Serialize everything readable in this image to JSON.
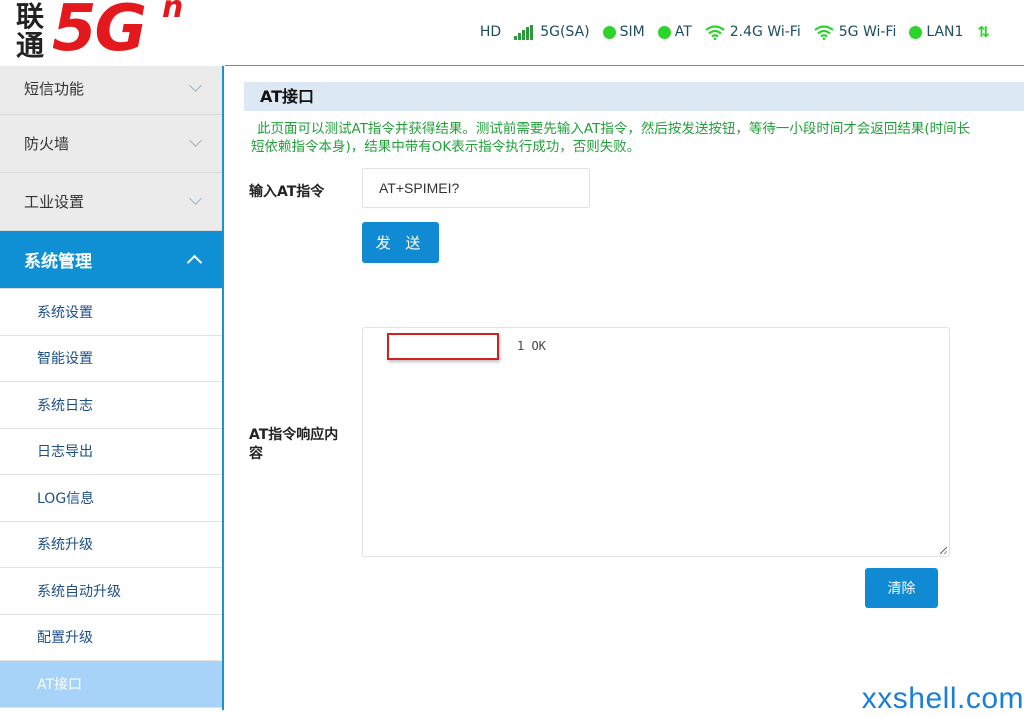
{
  "header": {
    "logo_cn": "联通",
    "logo_5g": "5G",
    "logo_n": "n",
    "status": {
      "hd": "HD",
      "network": "5G(SA)",
      "sim": "SIM",
      "at": "AT",
      "wifi24": "2.4G Wi-Fi",
      "wifi5": "5G Wi-Fi",
      "lan": "LAN1"
    },
    "colors": {
      "ok_dot": "#2bd32b",
      "brand_red": "#e4191d",
      "accent_blue": "#0f8fd4"
    }
  },
  "sidebar": {
    "sections": [
      {
        "label": "短信功能"
      },
      {
        "label": "防火墙"
      },
      {
        "label": "工业设置"
      },
      {
        "label": "系统管理"
      }
    ],
    "sub_items": [
      {
        "label": "系统设置"
      },
      {
        "label": "智能设置"
      },
      {
        "label": "系统日志"
      },
      {
        "label": "日志导出"
      },
      {
        "label": "LOG信息"
      },
      {
        "label": "系统升级"
      },
      {
        "label": "系统自动升级"
      },
      {
        "label": "配置升级"
      },
      {
        "label": "AT接口"
      }
    ]
  },
  "main": {
    "title": "AT接口",
    "description": "此页面可以测试AT指令并获得结果。测试前需要先输入AT指令，然后按发送按钮，等待一小段时间才会返回结果(时间长短依赖指令本身)，结果中带有OK表示指令执行成功，否则失败。",
    "input_label": "输入AT指令",
    "input_value": "AT+SPIMEI?",
    "send_button": "发 送",
    "response_label": "AT指令响应内容",
    "response_text": "1  OK",
    "clear_button": "清除"
  },
  "watermark": "xxshell.com"
}
